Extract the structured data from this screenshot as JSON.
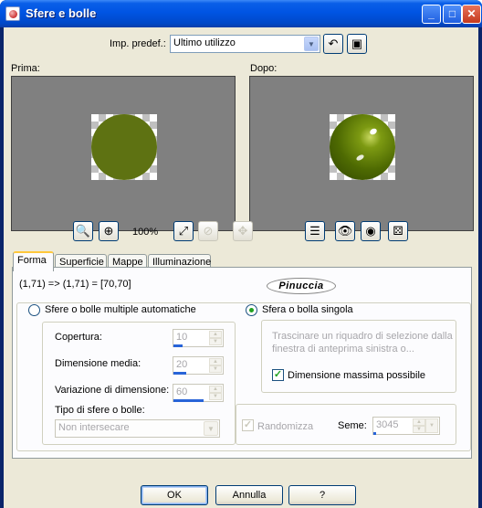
{
  "window": {
    "title": "Sfere e bolle",
    "controls": [
      "minimize-icon",
      "maximize-icon",
      "close-icon"
    ]
  },
  "preset": {
    "label": "Imp. predef.:",
    "value": "Ultimo utilizzo"
  },
  "previews": {
    "before_label": "Prima:",
    "after_label": "Dopo:",
    "zoom_level": "100%",
    "ball_color": "#5e7212",
    "preview_bg": "#808080"
  },
  "tabs": [
    {
      "label": "Forma",
      "active": true
    },
    {
      "label": "Superficie",
      "active": false
    },
    {
      "label": "Mappe",
      "active": false
    },
    {
      "label": "Illuminazione",
      "active": false
    }
  ],
  "forma": {
    "coords": "(1,71) => (1,71) = [70,70]",
    "logo_text": "Pinuccia",
    "multi_option": "Sfere o bolle multiple automatiche",
    "single_option": "Sfera o bolla singola",
    "single_hint": "Trascinare un riquadro di selezione dalla finestra di anteprima sinistra o...",
    "max_size_label": "Dimensione massima possibile",
    "coverage_label": "Copertura:",
    "coverage_value": "10",
    "avg_size_label": "Dimensione media:",
    "avg_size_value": "20",
    "size_var_label": "Variazione di dimensione:",
    "size_var_value": "60",
    "type_label": "Tipo di sfere o bolle:",
    "type_value": "Non intersecare",
    "randomize_label": "Randomizza",
    "seed_label": "Seme:",
    "seed_value": "3045"
  },
  "buttons": {
    "ok": "OK",
    "cancel": "Annulla",
    "help": "?"
  }
}
